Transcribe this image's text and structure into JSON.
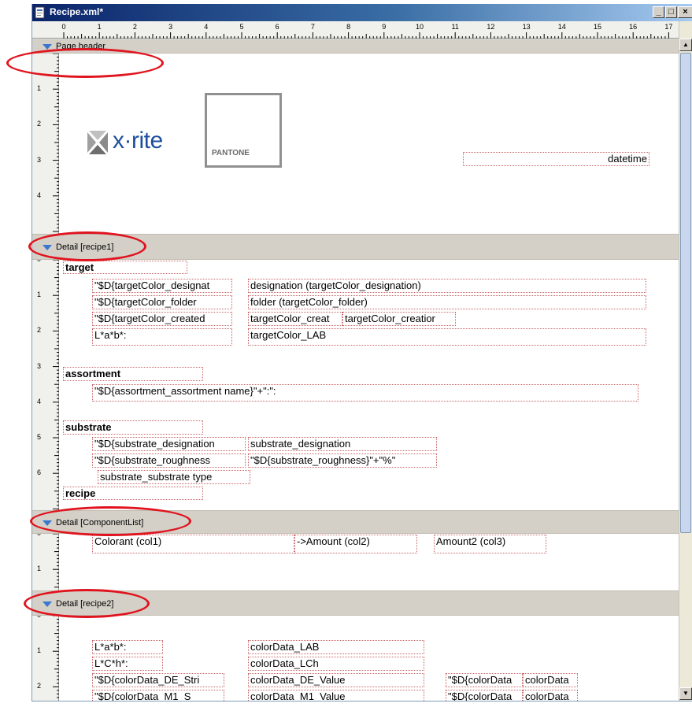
{
  "window": {
    "title": "Recipe.xml*",
    "buttons": {
      "minimize": "_",
      "maximize": "□",
      "close": "×"
    }
  },
  "ruler": {
    "h_numbers": [
      "0",
      "1",
      "2",
      "3",
      "4",
      "5",
      "6",
      "7",
      "8",
      "9",
      "10",
      "11",
      "12",
      "13",
      "14",
      "15",
      "16",
      "17"
    ],
    "header_v": [
      "1",
      "2",
      "3",
      "4"
    ],
    "recipe1_v": [
      "0",
      "1",
      "2",
      "3",
      "4",
      "5",
      "6"
    ],
    "comp_v": [
      "0",
      "1"
    ],
    "recipe2_v": [
      "0",
      "1",
      "2"
    ]
  },
  "bands": {
    "page_header": "Page header",
    "detail_recipe1": "Detail [recipe1]",
    "detail_componentlist": "Detail [ComponentList]",
    "detail_recipe2": "Detail [recipe2]"
  },
  "header": {
    "xrite_logo": "x·rite",
    "pantone_logo": "PANTONE",
    "datetime": "datetime"
  },
  "recipe1": {
    "target": "target",
    "tc_designation_expr": "\"$D{targetColor_designat",
    "tc_designation_val": "designation (targetColor_designation)",
    "tc_folder_expr": "\"$D{targetColor_folder",
    "tc_folder_val": "folder (targetColor_folder)",
    "tc_created_expr": "\"$D{targetColor_created",
    "tc_created_val": "targetColor_creat",
    "tc_creation_val": "targetColor_creatior",
    "lab_label": "L*a*b*:",
    "lab_val": "targetColor_LAB",
    "assortment": "assortment",
    "assortment_expr": "\"$D{assortment_assortment name}\"+\":\":",
    "substrate": "substrate",
    "sub_designation_expr": "\"$D{substrate_designation",
    "sub_designation_val": "substrate_designation",
    "sub_roughness_expr": "\"$D{substrate_roughness",
    "sub_roughness_val": "\"$D{substrate_roughness}\"+\"%\"",
    "sub_type": "substrate_substrate type",
    "recipe": "recipe"
  },
  "componentlist": {
    "col1": "Colorant (col1)",
    "col2": "->Amount (col2)",
    "col3": "Amount2 (col3)"
  },
  "recipe2": {
    "lab_label": "L*a*b*:",
    "lab_val": "colorData_LAB",
    "lch_label": "L*C*h*:",
    "lch_val": "colorData_LCh",
    "de_expr": "\"$D{colorData_DE_Stri",
    "de_val": "colorData_DE_Value",
    "de_expr2": "\"$D{colorData",
    "de_val2": "colorData",
    "m1_expr": "\"$D{colorData_M1_S",
    "m1_val": "colorData_M1_Value",
    "m1_expr2": "\"$D{colorData",
    "m1_val2": "colorData"
  },
  "colors": {
    "annotation": "#e0141e",
    "band": "#d4d0c8",
    "field_border": "#c86464",
    "band_triangle": "#3a78d0"
  }
}
